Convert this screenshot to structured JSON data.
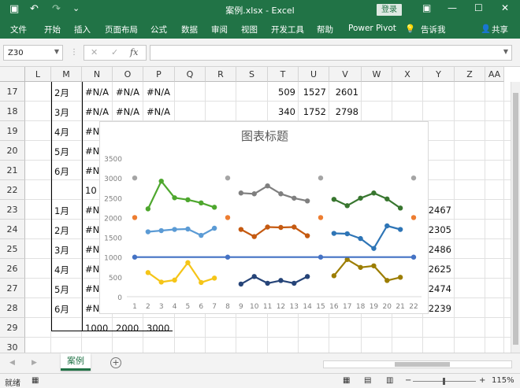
{
  "titlebar": {
    "title": "案例.xlsx  -  Excel",
    "login": "登录",
    "qa_save": "▣",
    "qa_undo": "↶",
    "qa_redo": "↷",
    "qa_custom": "⌄",
    "btn_ribbon_opts": "▣",
    "btn_min": "—",
    "btn_max": "☐",
    "btn_close": "✕"
  },
  "ribbon": {
    "tabs": [
      "文件",
      "开始",
      "插入",
      "页面布局",
      "公式",
      "数据",
      "审阅",
      "视图",
      "开发工具",
      "帮助",
      "Power Pivot",
      "告诉我"
    ],
    "tell_icon": "💡",
    "share": "共享"
  },
  "formula_bar": {
    "name_box": "Z30",
    "cancel": "✕",
    "enter": "✓",
    "fx": "fx",
    "value": ""
  },
  "columns": [
    "L",
    "M",
    "N",
    "O",
    "P",
    "Q",
    "R",
    "S",
    "T",
    "U",
    "V",
    "W",
    "X",
    "Y",
    "Z",
    "AA"
  ],
  "rows": [
    "17",
    "18",
    "19",
    "20",
    "21",
    "22",
    "23",
    "24",
    "25",
    "26",
    "27",
    "28",
    "29",
    "30"
  ],
  "cells": {
    "m17": "2月",
    "n17": "#N/A",
    "o17": "#N/A",
    "p17": "#N/A",
    "t17": "509",
    "u17": "1527",
    "v17": "2601",
    "m18": "3月",
    "n18": "#N/A",
    "o18": "#N/A",
    "p18": "#N/A",
    "t18": "340",
    "u18": "1752",
    "v18": "2798",
    "m19": "4月",
    "n19": "#N",
    "m20": "5月",
    "n20": "#N",
    "m21": "6月",
    "n21": "#N",
    "n22": "10",
    "m23": "1月",
    "n23": "#N",
    "y23": "2467",
    "m24": "2月",
    "n24": "#N",
    "y24": "2305",
    "m25": "3月",
    "n25": "#N",
    "y25": "2486",
    "m26": "4月",
    "n26": "#N",
    "y26": "2625",
    "m27": "5月",
    "n27": "#N",
    "y27": "2474",
    "m28": "6月",
    "n28": "#N",
    "y28": "2239",
    "n29": "1000",
    "o29": "2000",
    "p29": "3000"
  },
  "chart_data": {
    "type": "line",
    "title": "图表标题",
    "x": [
      1,
      2,
      3,
      4,
      5,
      6,
      7,
      8,
      9,
      10,
      11,
      12,
      13,
      14,
      15,
      16,
      17,
      18,
      19,
      20,
      21,
      22
    ],
    "ylim": [
      0,
      3500
    ],
    "yticks": [
      0,
      500,
      1000,
      1500,
      2000,
      2500,
      3000,
      3500
    ],
    "grid": false,
    "series": [
      {
        "color": "#4ea72e",
        "points": [
          [
            2,
            2220
          ],
          [
            3,
            2920
          ],
          [
            4,
            2500
          ],
          [
            5,
            2450
          ],
          [
            6,
            2370
          ],
          [
            7,
            2260
          ]
        ]
      },
      {
        "color": "#5b9bd5",
        "points": [
          [
            2,
            1640
          ],
          [
            3,
            1670
          ],
          [
            4,
            1700
          ],
          [
            5,
            1710
          ],
          [
            6,
            1550
          ],
          [
            7,
            1730
          ]
        ]
      },
      {
        "color": "#f5c518",
        "points": [
          [
            2,
            610
          ],
          [
            3,
            370
          ],
          [
            4,
            420
          ],
          [
            5,
            860
          ],
          [
            6,
            360
          ],
          [
            7,
            470
          ]
        ]
      },
      {
        "color": "#7f7f7f",
        "points": [
          [
            9,
            2620
          ],
          [
            10,
            2600
          ],
          [
            11,
            2800
          ],
          [
            12,
            2600
          ],
          [
            13,
            2490
          ],
          [
            14,
            2420
          ]
        ]
      },
      {
        "color": "#c55a11",
        "points": [
          [
            9,
            1700
          ],
          [
            10,
            1520
          ],
          [
            11,
            1760
          ],
          [
            12,
            1750
          ],
          [
            13,
            1760
          ],
          [
            14,
            1540
          ]
        ]
      },
      {
        "color": "#264478",
        "points": [
          [
            9,
            320
          ],
          [
            10,
            510
          ],
          [
            11,
            340
          ],
          [
            12,
            410
          ],
          [
            13,
            340
          ],
          [
            14,
            510
          ]
        ]
      },
      {
        "color": "#38762f",
        "points": [
          [
            16,
            2460
          ],
          [
            17,
            2300
          ],
          [
            18,
            2490
          ],
          [
            19,
            2620
          ],
          [
            20,
            2470
          ],
          [
            21,
            2240
          ]
        ]
      },
      {
        "color": "#2e75b6",
        "points": [
          [
            16,
            1600
          ],
          [
            17,
            1590
          ],
          [
            18,
            1470
          ],
          [
            19,
            1220
          ],
          [
            20,
            1790
          ],
          [
            21,
            1700
          ]
        ]
      },
      {
        "color": "#9c7d00",
        "points": [
          [
            16,
            530
          ],
          [
            17,
            940
          ],
          [
            18,
            740
          ],
          [
            19,
            780
          ],
          [
            20,
            410
          ],
          [
            21,
            490
          ]
        ]
      },
      {
        "color": "#a5a5a5",
        "markers_only": true,
        "points": [
          [
            1,
            3000
          ],
          [
            8,
            3000
          ],
          [
            15,
            3000
          ],
          [
            22,
            3000
          ]
        ]
      },
      {
        "color": "#ed7d31",
        "markers_only": true,
        "points": [
          [
            1,
            2000
          ],
          [
            8,
            2000
          ],
          [
            15,
            2000
          ],
          [
            22,
            2000
          ]
        ]
      },
      {
        "color": "#4472c4",
        "points": [
          [
            1,
            1000
          ],
          [
            8,
            1000
          ],
          [
            15,
            1000
          ],
          [
            22,
            1000
          ]
        ]
      }
    ]
  },
  "sheets": {
    "active": "案例",
    "nav_prev": "◀",
    "nav_next": "▶",
    "add": "+"
  },
  "status": {
    "ready": "就绪",
    "zoom": "115%",
    "zoom_minus": "−",
    "zoom_plus": "+"
  }
}
